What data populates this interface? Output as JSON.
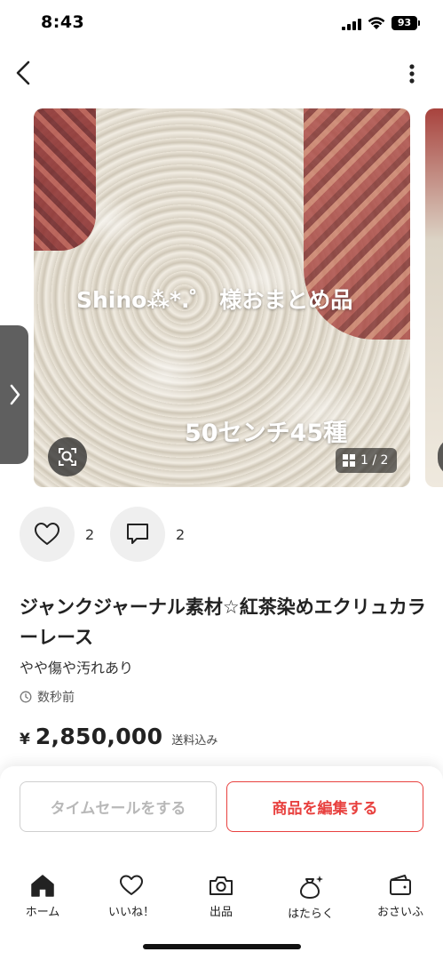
{
  "status_bar": {
    "time": "8:43",
    "battery": "93"
  },
  "photo": {
    "overlay_text_1": "Shino⁂*.゜ 様おまとめ品",
    "overlay_text_2": "50センチ45種",
    "counter": "1 / 2"
  },
  "actions": {
    "likes": "2",
    "comments": "2"
  },
  "item": {
    "title": "ジャンクジャーナル素材☆紅茶染めエクリュカラーレース",
    "condition": "やや傷や汚れあり",
    "posted": "数秒前",
    "currency": "¥",
    "price": "2,850,000",
    "shipping_note": "送料込み"
  },
  "buttons": {
    "timesale": "タイムセールをする",
    "edit": "商品を編集する"
  },
  "tabbar": [
    {
      "label": "ホーム",
      "icon": "home-icon"
    },
    {
      "label": "いいね！",
      "icon": "heart-icon"
    },
    {
      "label": "出品",
      "icon": "camera-icon"
    },
    {
      "label": "はたらく",
      "icon": "money-bag-icon"
    },
    {
      "label": "おさいふ",
      "icon": "wallet-icon"
    }
  ],
  "colors": {
    "accent": "#e8413f",
    "sidetab": "#5f5f5f"
  }
}
